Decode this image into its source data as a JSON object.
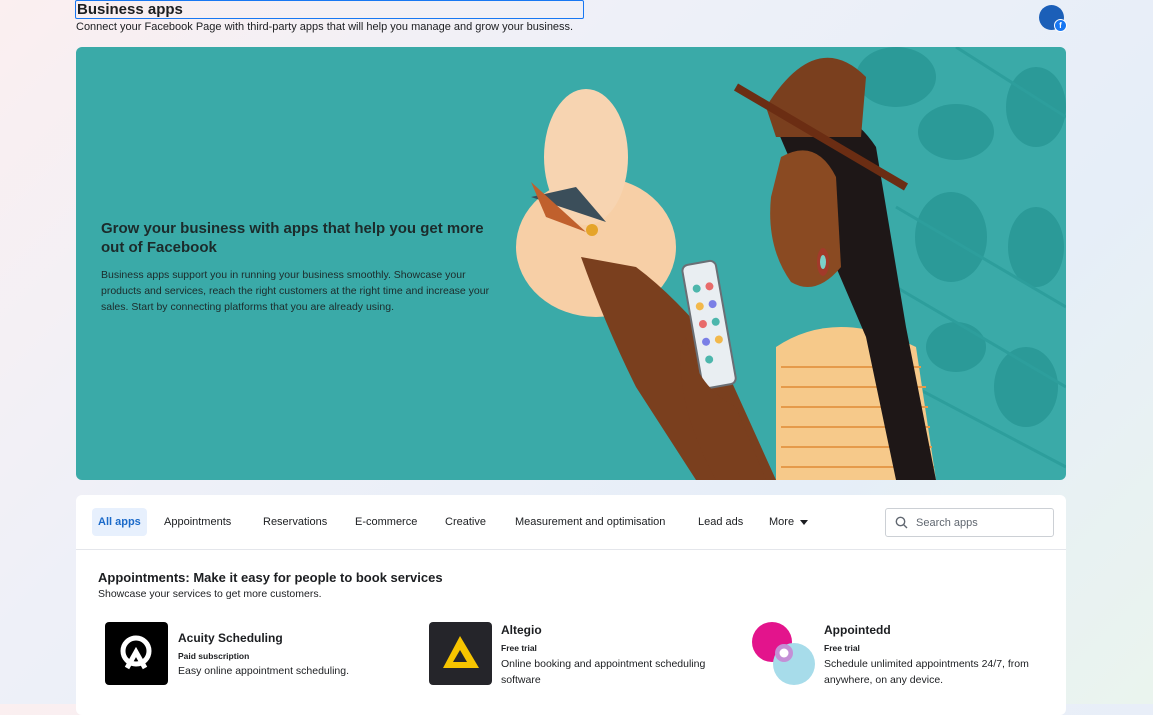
{
  "header": {
    "title": "Business apps",
    "subtitle": "Connect your Facebook Page with third-party apps that will help you manage and grow your business."
  },
  "hero": {
    "heading": "Grow your business with apps that help you get more out of Facebook",
    "body": "Business apps support you in running your business smoothly. Showcase your products and services, reach the right customers at the right time and increase your sales. Start by connecting platforms that you are already using.",
    "background_color": "#3aaaa8"
  },
  "tabs": [
    {
      "label": "All apps",
      "active": true
    },
    {
      "label": "Appointments"
    },
    {
      "label": "Reservations"
    },
    {
      "label": "E-commerce"
    },
    {
      "label": "Creative"
    },
    {
      "label": "Measurement and optimisation"
    },
    {
      "label": "Lead ads"
    },
    {
      "label": "More"
    }
  ],
  "search": {
    "placeholder": "Search apps",
    "icon": "search-icon"
  },
  "section": {
    "title": "Appointments: Make it easy for people to book services",
    "subtitle": "Showcase your services to get more customers."
  },
  "apps": [
    {
      "name": "Acuity Scheduling",
      "price": "Paid subscription",
      "description": "Easy online appointment scheduling."
    },
    {
      "name": "Altegio",
      "price": "Free trial",
      "description": "Online booking and appointment scheduling software"
    },
    {
      "name": "Appointedd",
      "price": "Free trial",
      "description": "Schedule unlimited appointments 24/7, from anywhere, on any device."
    }
  ],
  "colors": {
    "accent": "#1877f2",
    "active_tab_bg": "#e7f0fd",
    "active_tab_text": "#1b6ac9"
  }
}
